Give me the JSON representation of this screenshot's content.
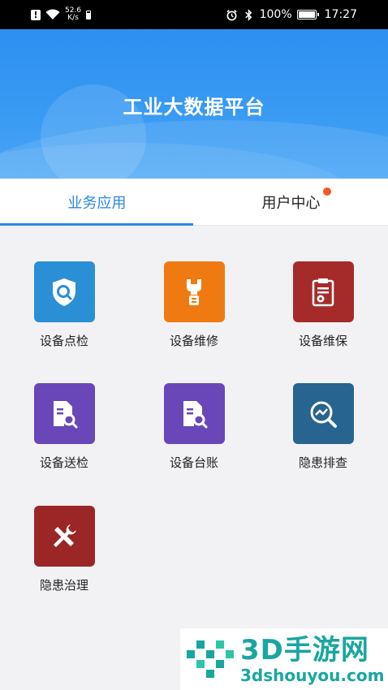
{
  "status_bar": {
    "net_speed_value": "52.6",
    "net_speed_unit": "K/s",
    "battery_percent": "100%",
    "time": "17:27"
  },
  "header": {
    "title": "工业大数据平台"
  },
  "tabs": [
    {
      "label": "业务应用",
      "active": true
    },
    {
      "label": "用户中心",
      "active": false,
      "badge": true
    }
  ],
  "apps": [
    {
      "label": "设备点检",
      "color": "#2a8fd4",
      "icon": "shield-search-icon"
    },
    {
      "label": "设备维修",
      "color": "#f07a12",
      "icon": "wrench-icon"
    },
    {
      "label": "设备维保",
      "color": "#a52b2b",
      "icon": "clipboard-gear-icon"
    },
    {
      "label": "设备送检",
      "color": "#6a47b8",
      "icon": "document-search-icon"
    },
    {
      "label": "设备台账",
      "color": "#6a47b8",
      "icon": "document-search-icon"
    },
    {
      "label": "隐患排查",
      "color": "#27648f",
      "icon": "magnifier-chart-icon"
    },
    {
      "label": "隐患治理",
      "color": "#9b2626",
      "icon": "tools-icon"
    }
  ],
  "watermark": {
    "brand": "3D手游网",
    "site": "3dshouyou.com"
  }
}
